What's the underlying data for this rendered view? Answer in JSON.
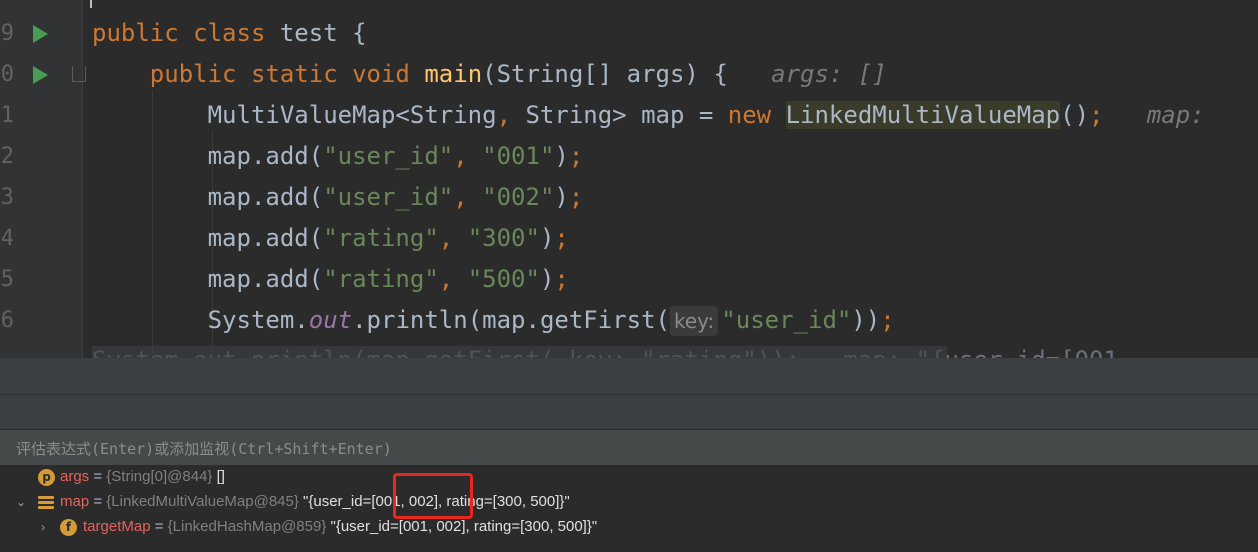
{
  "editor": {
    "lines": [
      {
        "num": "9"
      },
      {
        "num": "0",
        "hint": "args: []"
      },
      {
        "num": "1",
        "hint": "map:"
      },
      {
        "num": "2"
      },
      {
        "num": "3"
      },
      {
        "num": "4"
      },
      {
        "num": "5"
      },
      {
        "num": "6",
        "param_hint": "key:"
      }
    ],
    "line7_partial": "System.out.println(map.getFirst( key: \"rating\"));   map: \"{user_id=[001,"
  },
  "debugger": {
    "eval_placeholder": "评估表达式(Enter)或添加监视(Ctrl+Shift+Enter)",
    "variables": [
      {
        "name": "args",
        "eq": " = ",
        "type": "{String[0]@844}",
        "value": " []",
        "icon": "p-icon"
      },
      {
        "name": "map",
        "eq": " = ",
        "type": "{LinkedMultiValueMap@845}",
        "value": " \"{user_id=[001, 002], rating=[300, 500]}\"",
        "icon": "list-icon",
        "expanded": true
      },
      {
        "name": "targetMap",
        "eq": " = ",
        "type": "{LinkedHashMap@859}",
        "value": " \"{user_id=[001, 002], rating=[300, 500]}\"",
        "icon": "f-icon"
      }
    ]
  },
  "colors": {
    "keyword": "#cc7832",
    "string": "#6a8759",
    "method": "#ffc66d",
    "highlight_box": "#e8281e"
  }
}
